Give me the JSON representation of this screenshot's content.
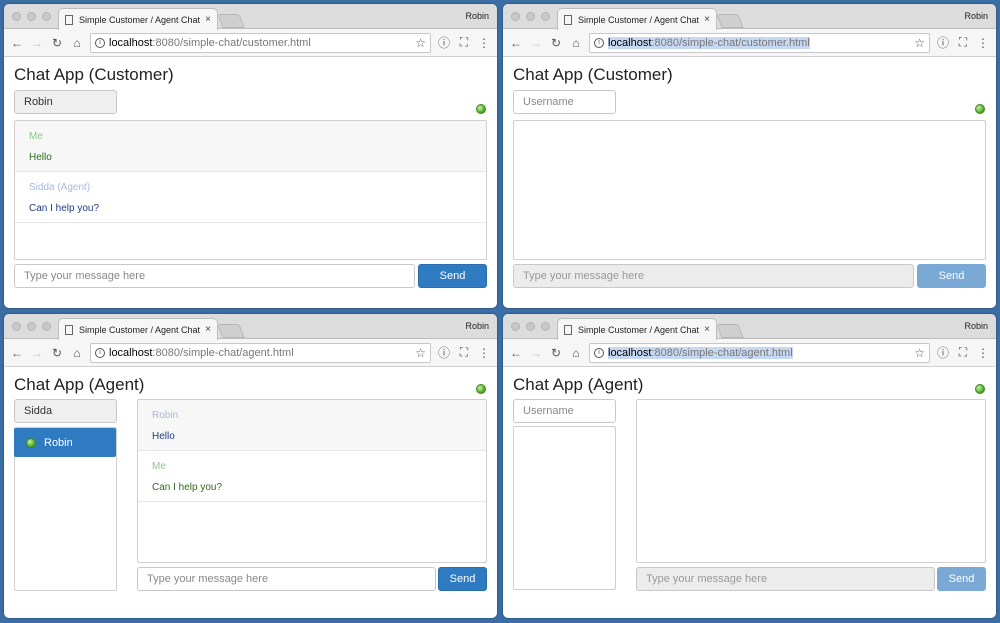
{
  "browser": {
    "tab_title": "Simple Customer / Agent Chat",
    "profile": "Robin",
    "tab_close": "×",
    "nav": {
      "back": "←",
      "forward": "→",
      "reload": "↻",
      "home": "⌂",
      "info": "i",
      "star": "☆",
      "info2": "ⓘ",
      "fullscreen": "⛶",
      "menu": "⋮"
    }
  },
  "windows": {
    "customer_active": {
      "url_host": "localhost",
      "url_path": ":8080/simple-chat/customer.html",
      "title": "Chat App (Customer)",
      "username": "Robin",
      "messages": [
        {
          "sender": "Me",
          "text": "Hello"
        },
        {
          "sender": "Sidda (Agent)",
          "text": "Can I help you?"
        }
      ],
      "message_placeholder": "Type your message here",
      "send_label": "Send"
    },
    "customer_empty": {
      "url_host": "localhost",
      "url_path": ":8080/simple-chat/customer.html",
      "title": "Chat App (Customer)",
      "username_placeholder": "Username",
      "message_placeholder": "Type your message here",
      "send_label": "Send"
    },
    "agent_active": {
      "url_host": "localhost",
      "url_path": ":8080/simple-chat/agent.html",
      "title": "Chat App (Agent)",
      "username": "Sidda",
      "customers": [
        {
          "name": "Robin"
        }
      ],
      "messages": [
        {
          "sender": "Robin",
          "text": "Hello"
        },
        {
          "sender": "Me",
          "text": "Can I help you?"
        }
      ],
      "message_placeholder": "Type your message here",
      "send_label": "Send"
    },
    "agent_empty": {
      "url_host": "localhost",
      "url_path": ":8080/simple-chat/agent.html",
      "title": "Chat App (Agent)",
      "username_placeholder": "Username",
      "message_placeholder": "Type your message here",
      "send_label": "Send"
    }
  }
}
